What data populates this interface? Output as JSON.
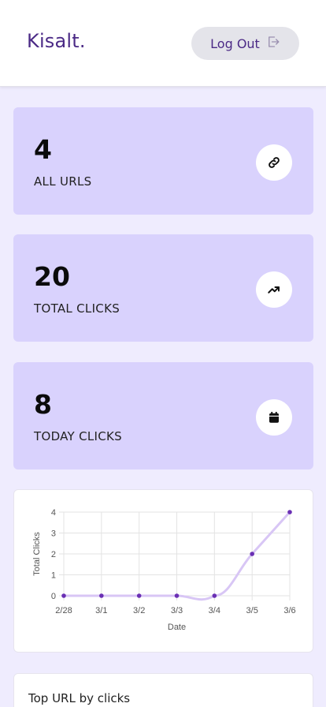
{
  "header": {
    "brand": "Kisalt.",
    "logout_label": "Log Out"
  },
  "stats": [
    {
      "value": "4",
      "label": "ALL URLS",
      "icon": "link-icon"
    },
    {
      "value": "20",
      "label": "TOTAL CLICKS",
      "icon": "trending-up-icon"
    },
    {
      "value": "8",
      "label": "TODAY CLICKS",
      "icon": "calendar-icon"
    }
  ],
  "colors": {
    "brand": "#4b2a86",
    "card_bg": "#d9d2fd",
    "page_bg": "#efecfe",
    "line": "#d8c6f5",
    "point": "#6a2fb4"
  },
  "chart_data": {
    "type": "line",
    "x": [
      "2/28",
      "3/1",
      "3/2",
      "3/3",
      "3/4",
      "3/5",
      "3/6"
    ],
    "series": [
      {
        "values": [
          0,
          0,
          0,
          0,
          0,
          2,
          4
        ]
      }
    ],
    "xlabel": "Date",
    "ylabel": "Total Clicks",
    "ylim": [
      0,
      4
    ],
    "yticks": [
      "0",
      "1",
      "2",
      "3",
      "4"
    ],
    "grid": true
  },
  "top_urls": {
    "title": "Top URL by clicks"
  }
}
